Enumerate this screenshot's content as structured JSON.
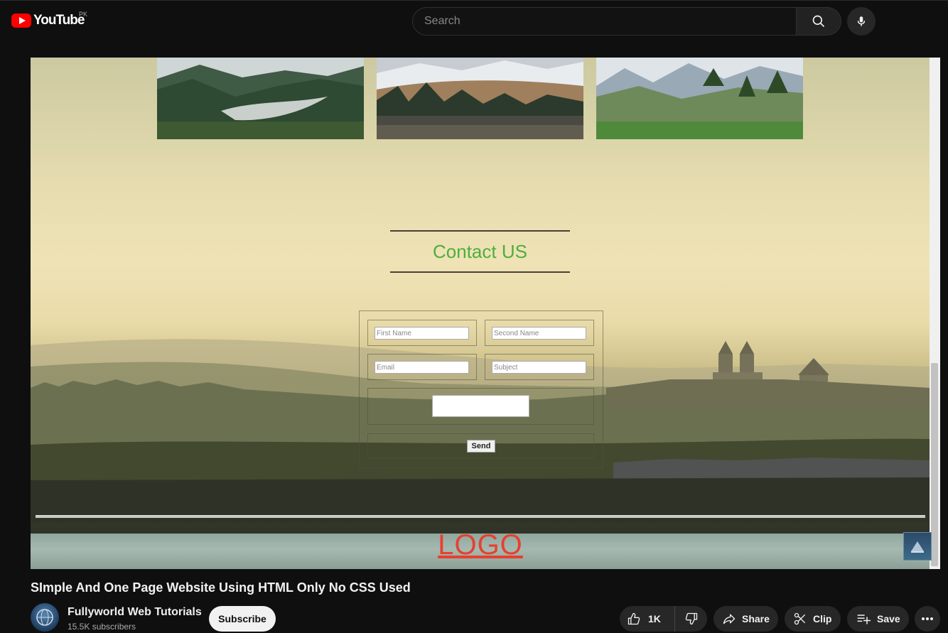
{
  "header": {
    "brand": "YouTube",
    "region": "PK",
    "search_placeholder": "Search"
  },
  "video": {
    "page_heading": "Contact US",
    "form": {
      "first_name_placeholder": "First Name",
      "second_name_placeholder": "Second Name",
      "email_placeholder": "Email",
      "subject_placeholder": "Subject",
      "send_label": "Send"
    },
    "footer_logo": "LOGO"
  },
  "details": {
    "title": "SImple And One Page Website Using HTML Only No CSS Used",
    "channel_name": "Fullyworld Web Tutorials",
    "subscribers": "15.5K subscribers",
    "subscribe_label": "Subscribe",
    "likes": "1K",
    "share_label": "Share",
    "clip_label": "Clip",
    "save_label": "Save"
  },
  "colors": {
    "brand_red": "#ff0000",
    "contact_green": "#4fae3c",
    "logo_red": "#e8402e"
  },
  "icons": [
    "youtube-logo-icon",
    "search-icon",
    "mic-icon",
    "like-icon",
    "dislike-icon",
    "share-icon",
    "scissors-icon",
    "playlist-add-icon",
    "more-icon"
  ]
}
